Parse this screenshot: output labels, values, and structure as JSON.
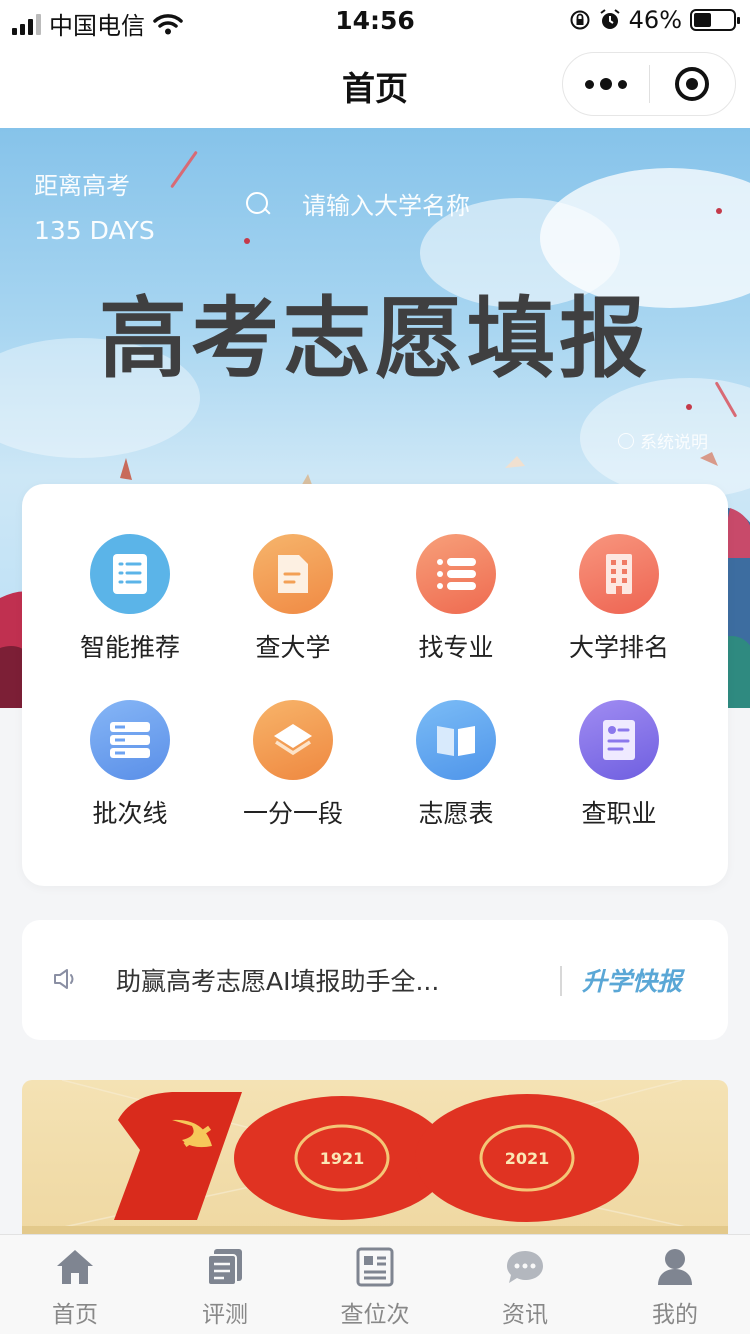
{
  "status_bar": {
    "carrier": "中国电信",
    "time": "14:56",
    "battery": "46%",
    "battery_level": 0.46
  },
  "nav": {
    "title": "首页"
  },
  "banner": {
    "countdown_label": "距离高考",
    "countdown_value": "135 DAYS",
    "search_placeholder": "请输入大学名称",
    "title": "高考志愿填报",
    "system_note": "系统说明"
  },
  "menu": {
    "items": [
      {
        "label": "智能推荐",
        "icon": "document-list-icon",
        "color": "#5bb4e8"
      },
      {
        "label": "查大学",
        "icon": "file-icon",
        "color": "#f4a45b"
      },
      {
        "label": "找专业",
        "icon": "list-icon",
        "color": "#f48764"
      },
      {
        "label": "大学排名",
        "icon": "building-icon",
        "color": "#f47d6a"
      },
      {
        "label": "批次线",
        "icon": "server-icon",
        "color": "#6ea3f2"
      },
      {
        "label": "一分一段",
        "icon": "layers-icon",
        "color": "#f49b50"
      },
      {
        "label": "志愿表",
        "icon": "book-icon",
        "color": "#5fa8f2"
      },
      {
        "label": "查职业",
        "icon": "profile-card-icon",
        "color": "#8b78ec"
      }
    ]
  },
  "news": {
    "text": "助赢高考志愿AI填报助手全...",
    "tag": "升学快报"
  },
  "promo": {
    "year_left": "1921",
    "year_right": "2021"
  },
  "tabs": [
    {
      "label": "首页",
      "icon": "home-icon"
    },
    {
      "label": "评测",
      "icon": "clipboard-icon"
    },
    {
      "label": "查位次",
      "icon": "rank-sheet-icon"
    },
    {
      "label": "资讯",
      "icon": "chat-bubble-icon"
    },
    {
      "label": "我的",
      "icon": "user-icon"
    }
  ]
}
